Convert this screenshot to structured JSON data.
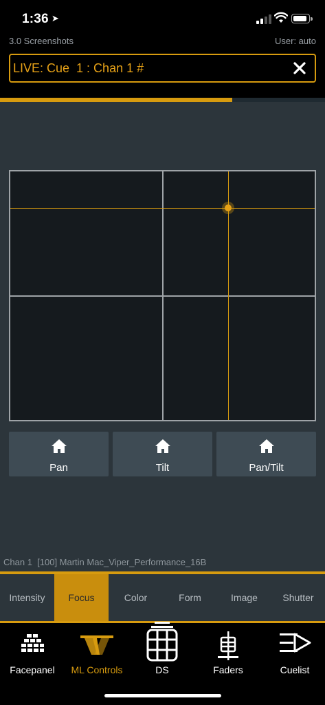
{
  "status_bar": {
    "time": "1:36"
  },
  "header": {
    "show_name": "3.0 Screenshots",
    "user": "User: auto",
    "command_line": "LIVE: Cue  1 : Chan 1 #",
    "cue_progress": 0.715
  },
  "focus": {
    "pan": 0.715,
    "tilt": 0.148,
    "home_buttons": [
      {
        "label": "Pan"
      },
      {
        "label": "Tilt"
      },
      {
        "label": "Pan/Tilt"
      }
    ],
    "device_info": "Chan 1  [100] Martin Mac_Viper_Performance_16B"
  },
  "tabs": [
    {
      "label": "Intensity",
      "active": false
    },
    {
      "label": "Focus",
      "active": true
    },
    {
      "label": "Color",
      "active": false
    },
    {
      "label": "Form",
      "active": false
    },
    {
      "label": "Image",
      "active": false
    },
    {
      "label": "Shutter",
      "active": false
    }
  ],
  "bottom_nav": [
    {
      "label": "Facepanel",
      "icon": "facepanel-icon",
      "active": false
    },
    {
      "label": "ML Controls",
      "icon": "ml-controls-icon",
      "active": true
    },
    {
      "label": "DS",
      "icon": "direct-selects-icon",
      "active": false
    },
    {
      "label": "Faders",
      "icon": "faders-icon",
      "active": false
    },
    {
      "label": "Cuelist",
      "icon": "cuelist-icon",
      "active": false
    }
  ],
  "colors": {
    "accent": "#d79b0f",
    "background": "#2c353b",
    "pad": "#151a1e"
  }
}
